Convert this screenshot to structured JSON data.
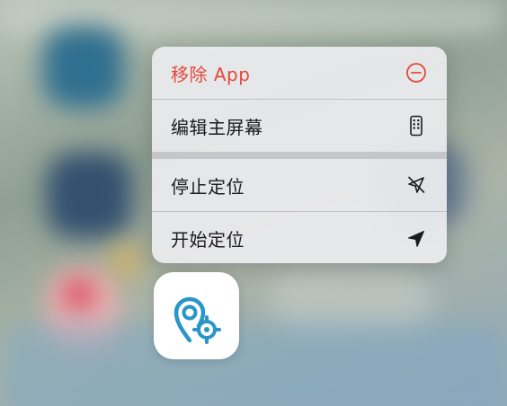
{
  "menu": {
    "items": [
      {
        "label": "移除 App",
        "icon": "minus-circle-icon",
        "destructive": true
      },
      {
        "label": "编辑主屏幕",
        "icon": "phone-grid-icon"
      },
      {
        "label": "停止定位",
        "icon": "location-slash-icon"
      },
      {
        "label": "开始定位",
        "icon": "location-arrow-icon"
      }
    ]
  },
  "app": {
    "icon": "location-target-app-icon"
  },
  "colors": {
    "destructive": "#e5483c",
    "accent": "#2996c8"
  }
}
